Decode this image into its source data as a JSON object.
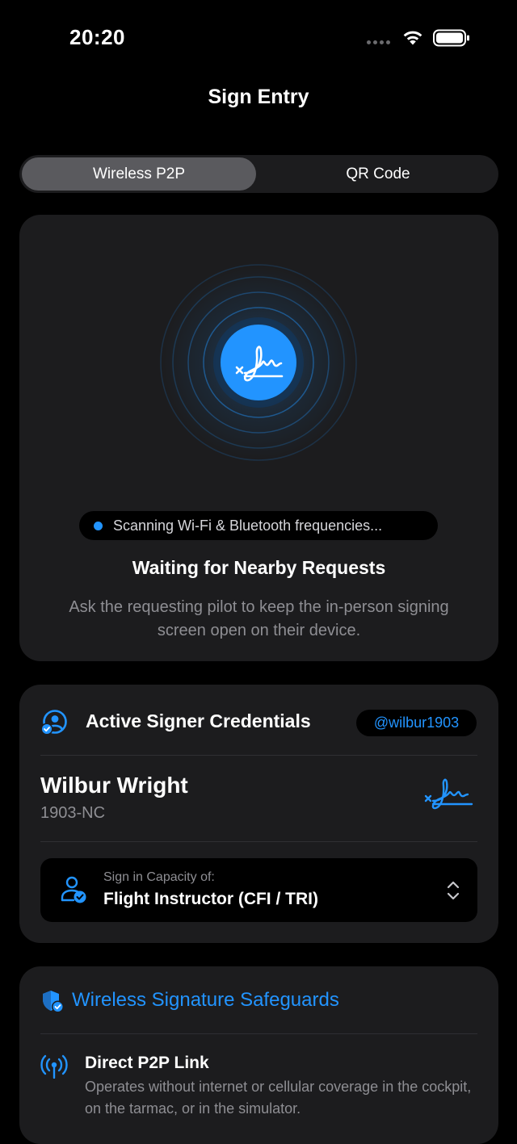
{
  "status_bar": {
    "time": "20:20"
  },
  "nav": {
    "title": "Sign Entry"
  },
  "segmented": {
    "options": [
      "Wireless P2P",
      "QR Code"
    ],
    "selected": "Wireless P2P"
  },
  "scan_card": {
    "status": "Scanning Wi-Fi & Bluetooth frequencies...",
    "title": "Waiting for Nearby Requests",
    "description": "Ask the requesting pilot to keep the in-person signing screen open on their device.",
    "icon": "signature-icon"
  },
  "credentials": {
    "heading": "Active Signer Credentials",
    "handle": "@wilbur1903",
    "name": "Wilbur Wright",
    "registration": "1903-NC",
    "capacity_label": "Sign in Capacity of:",
    "capacity_value": "Flight Instructor (CFI / TRI)"
  },
  "safeguards": {
    "heading": "Wireless Signature Safeguards",
    "items": [
      {
        "title": "Direct P2P Link",
        "description": "Operates without internet or cellular coverage in the cockpit, on the tarmac, or in the simulator.",
        "icon": "antenna-icon"
      }
    ]
  },
  "colors": {
    "accent": "#2294ff",
    "background": "#000000",
    "card": "#1c1c1e",
    "secondary_text": "#8e8e93"
  }
}
